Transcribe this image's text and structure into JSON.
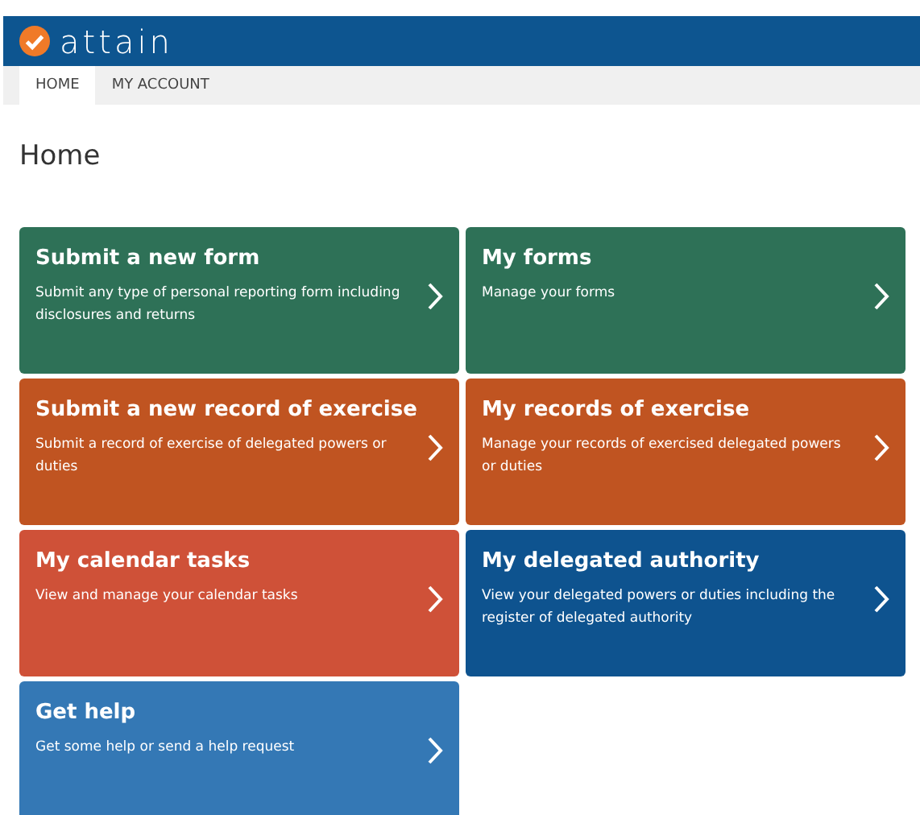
{
  "header": {
    "logo_text": "attain"
  },
  "nav": [
    {
      "label": "HOME",
      "selected": true
    },
    {
      "label": "MY ACCOUNT",
      "selected": false
    }
  ],
  "page_title": "Home",
  "tiles": [
    {
      "title": "Submit a new form",
      "description": "Submit any type of personal reporting form including disclosures and returns",
      "color": "#2e7157"
    },
    {
      "title": "My forms",
      "description": "Manage your forms",
      "color": "#2e7157"
    },
    {
      "title": "Submit a new record of exercise",
      "description": "Submit a record of exercise of delegated powers or duties",
      "color": "#c05421"
    },
    {
      "title": "My records of exercise",
      "description": "Manage your records of exercised delegated powers or duties",
      "color": "#c05421"
    },
    {
      "title": "My calendar tasks",
      "description": "View and manage your calendar tasks",
      "color": "#cf5138"
    },
    {
      "title": "My delegated authority",
      "description": "View your delegated powers or duties including the register of delegated authority",
      "color": "#0e538f"
    },
    {
      "title": "Get help",
      "description": "Get some help or send a help request",
      "color": "#3478b5"
    }
  ]
}
